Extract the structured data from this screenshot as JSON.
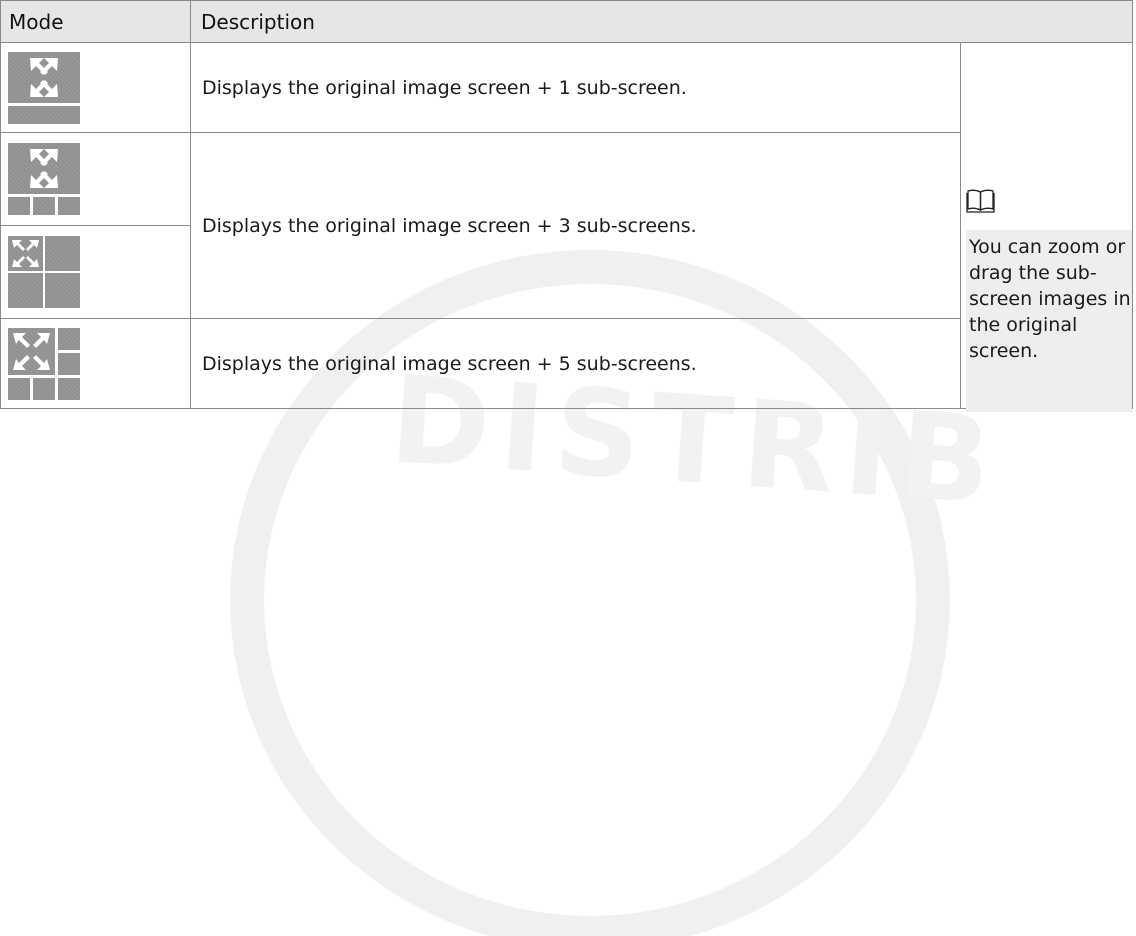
{
  "table": {
    "headers": {
      "mode": "Mode",
      "description": "Description"
    },
    "rows": [
      {
        "layout": "original-plus-1",
        "description": "Displays the original image screen + 1 sub-screen."
      },
      {
        "layout": "original-plus-3-bottom",
        "description": "Displays the original image screen + 3 sub-screens."
      },
      {
        "layout": "original-plus-3-quad",
        "description": ""
      },
      {
        "layout": "original-plus-5",
        "description": "Displays the original image screen + 5 sub-screens."
      }
    ]
  },
  "note": {
    "icon": "book-icon",
    "text": "You can zoom or drag the sub-screen images in the original screen."
  },
  "colors": {
    "header_bg": "#e6e6e6",
    "tile_gray": "#909090",
    "note_bg": "#eeeeee",
    "border": "#8a8a8a"
  }
}
